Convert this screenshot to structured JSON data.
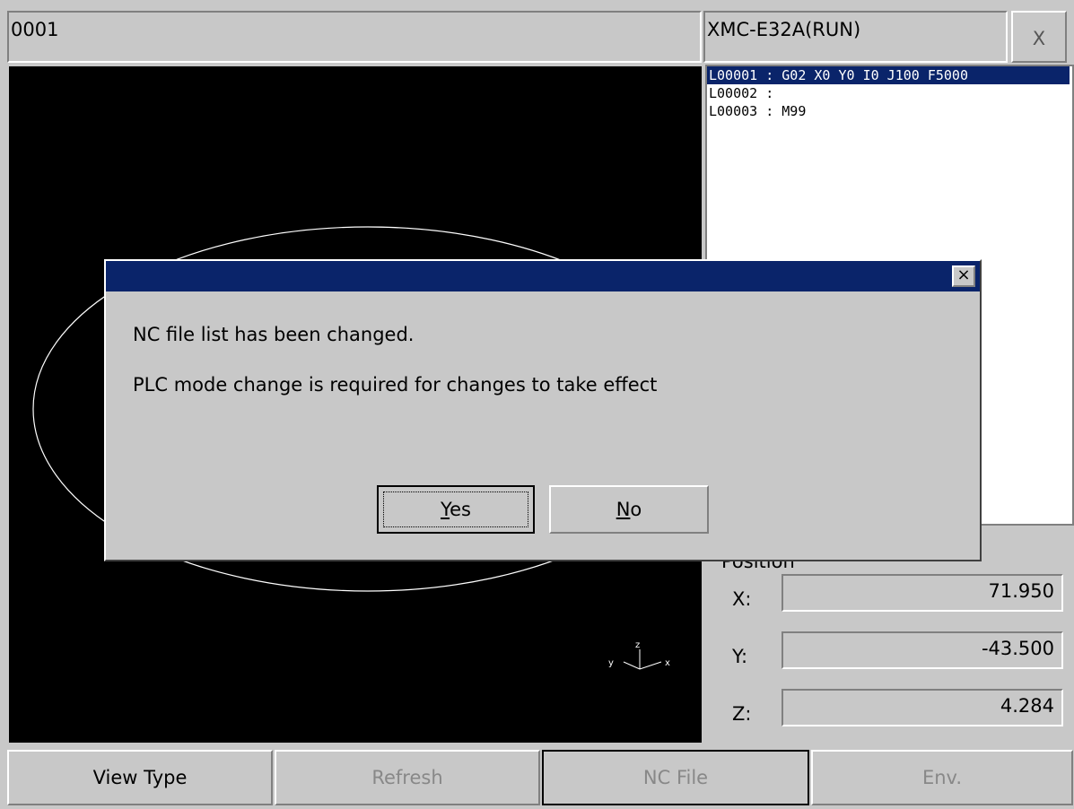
{
  "header": {
    "program_name": "0001",
    "plc_status": "XMC-E32A(RUN)",
    "close_label": "X"
  },
  "code_list": {
    "lines": [
      "L00001 : G02 X0 Y0 I0 J100 F5000",
      "L00002 :",
      "L00003 : M99"
    ],
    "selected_index": 0
  },
  "graphic": {
    "axis_labels": {
      "x": "x",
      "y": "y",
      "z": "z"
    }
  },
  "position": {
    "title": "Position",
    "axes": [
      {
        "label": "X:",
        "value": "71.950"
      },
      {
        "label": "Y:",
        "value": "-43.500"
      },
      {
        "label": "Z:",
        "value": "4.284"
      }
    ]
  },
  "bottom_buttons": [
    {
      "label": "View Type",
      "enabled": true
    },
    {
      "label": "Refresh",
      "enabled": false
    },
    {
      "label": "NC File",
      "enabled": false
    },
    {
      "label": "Env.",
      "enabled": false
    }
  ],
  "dialog": {
    "close_label": "×",
    "message_line1": "NC file list has been changed.",
    "message_line2": "PLC mode change is required for changes to take effect",
    "yes_mnemonic": "Y",
    "yes_rest": "es",
    "no_mnemonic": "N",
    "no_rest": "o"
  }
}
